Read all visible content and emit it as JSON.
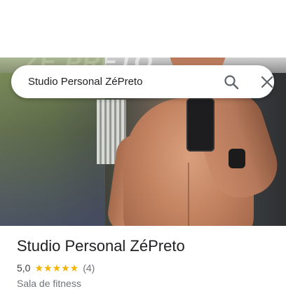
{
  "search": {
    "query": "Studio Personal ZéPreto"
  },
  "hero": {
    "logo_text": "ZÉ PRETO"
  },
  "place": {
    "title": "Studio Personal ZéPreto",
    "rating": "5,0",
    "stars": "★★★★★",
    "review_count": "(4)",
    "category": "Sala de fitness"
  },
  "colors": {
    "star": "#f4b400",
    "title_text": "#202124",
    "secondary_text": "#70757a"
  },
  "icons": {
    "search": "search-icon",
    "close": "close-icon"
  }
}
